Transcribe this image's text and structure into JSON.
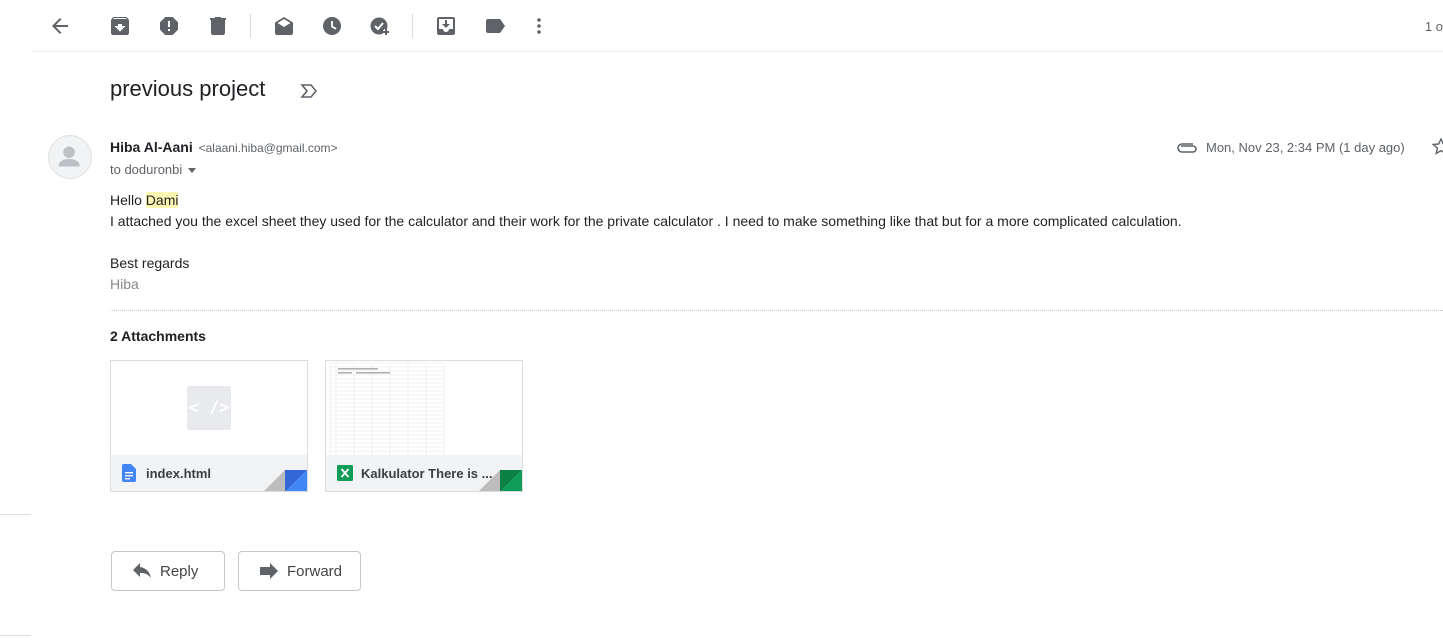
{
  "toolbar": {
    "icons": [
      "back-arrow-icon",
      "archive-icon",
      "report-spam-icon",
      "delete-icon",
      "mark-unread-icon",
      "snooze-icon",
      "add-to-tasks-icon",
      "move-to-icon",
      "labels-icon",
      "more-vert-icon"
    ],
    "pager": "1 o"
  },
  "message": {
    "subject": "previous project",
    "sender_name": "Hiba Al-Aani",
    "sender_email": "<alaani.hiba@gmail.com>",
    "to": "to doduronbi",
    "date": "Mon, Nov 23, 2:34 PM (1 day ago)",
    "body": {
      "greeting": "Hello",
      "greeting_name": "Dami",
      "line1": "I attached you the excel sheet they used for the calculator and their work for the private calculator . I need to make something like that but for a more complicated calculation.",
      "closing": "Best regards",
      "signature": "Hiba"
    }
  },
  "attachments": {
    "title": "2 Attachments",
    "items": [
      {
        "name": "index.html",
        "type": "html",
        "color": "#4285f4"
      },
      {
        "name": "Kalkulator There is ...",
        "type": "excel",
        "color": "#0f9d58"
      }
    ],
    "code_glyph": "< />",
    "excel_glyph": "X"
  },
  "actions": {
    "reply": "Reply",
    "forward": "Forward"
  }
}
